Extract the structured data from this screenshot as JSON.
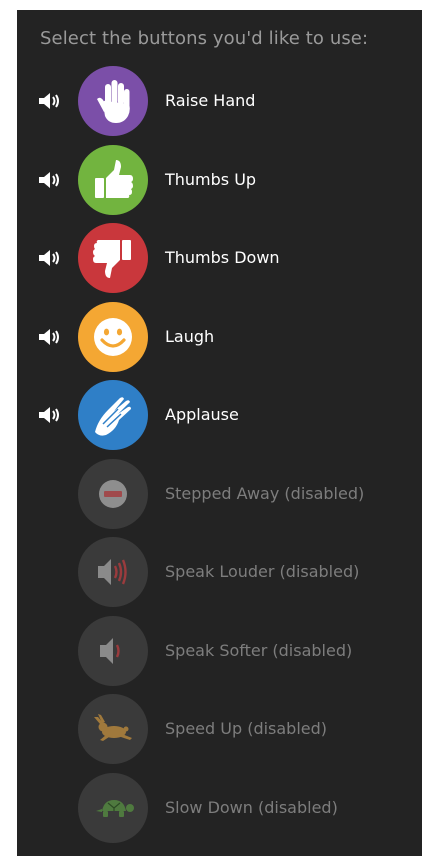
{
  "heading": "Select the buttons you'd like to use:",
  "buttons": [
    {
      "label": "Raise Hand",
      "color": "#7b4fa8",
      "icon": "raised-hand-icon",
      "sound": true
    },
    {
      "label": "Thumbs Up",
      "color": "#72b43f",
      "icon": "thumbs-up-icon",
      "sound": true
    },
    {
      "label": "Thumbs Down",
      "color": "#c9373c",
      "icon": "thumbs-down-icon",
      "sound": true
    },
    {
      "label": "Laugh",
      "color": "#f4a733",
      "icon": "smiley-face-icon",
      "sound": true
    },
    {
      "label": "Applause",
      "color": "#2f7fc7",
      "icon": "clapping-hands-icon",
      "sound": true
    },
    {
      "label": "Stepped Away (disabled)",
      "color": "#3a3a3a",
      "icon": "stepped-away-icon",
      "sound": false
    },
    {
      "label": "Speak Louder (disabled)",
      "color": "#3a3a3a",
      "icon": "speak-louder-icon",
      "sound": false
    },
    {
      "label": "Speak Softer (disabled)",
      "color": "#3a3a3a",
      "icon": "speak-softer-icon",
      "sound": false
    },
    {
      "label": "Speed Up (disabled)",
      "color": "#3a3a3a",
      "icon": "rabbit-icon",
      "sound": false
    },
    {
      "label": "Slow Down (disabled)",
      "color": "#3a3a3a",
      "icon": "turtle-icon",
      "sound": false
    }
  ]
}
